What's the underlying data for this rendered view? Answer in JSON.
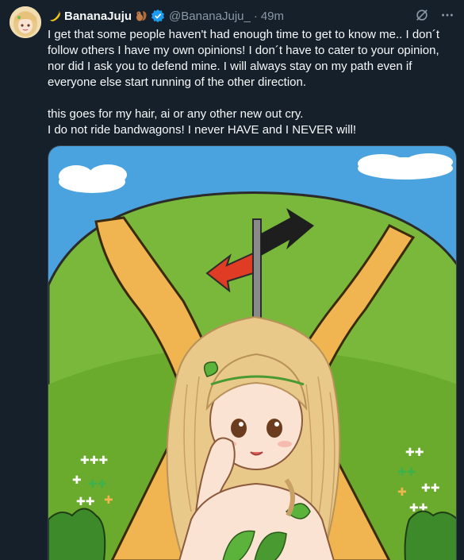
{
  "tweet": {
    "display_name": "BananaJuju",
    "handle": "@BananaJuju_",
    "separator": "·",
    "time": "49m",
    "text_lines": [
      "I get that some people haven't had enough time to get to know me.. I don´t",
      "follow others I have my own opinions! I don´t have to cater to your opinion,",
      "nor did I ask you to defend mine. I will always stay on my path even if",
      "everyone else start running of the other direction.",
      "",
      "this goes for my hair, ai or any other new out cry.",
      "I do not ride bandwagons! I never HAVE and I NEVER will!"
    ],
    "media_alt": "illustration"
  },
  "icons": {
    "name_prefix": "banana-icon",
    "name_suffix": "squirrel-icon",
    "verified": "verified-badge-icon",
    "grok": "grok-icon",
    "more": "more-icon"
  },
  "colors": {
    "background": "#15202b",
    "text": "#f7f9f9",
    "muted": "#8b98a5",
    "verified": "#1d9bf0"
  }
}
